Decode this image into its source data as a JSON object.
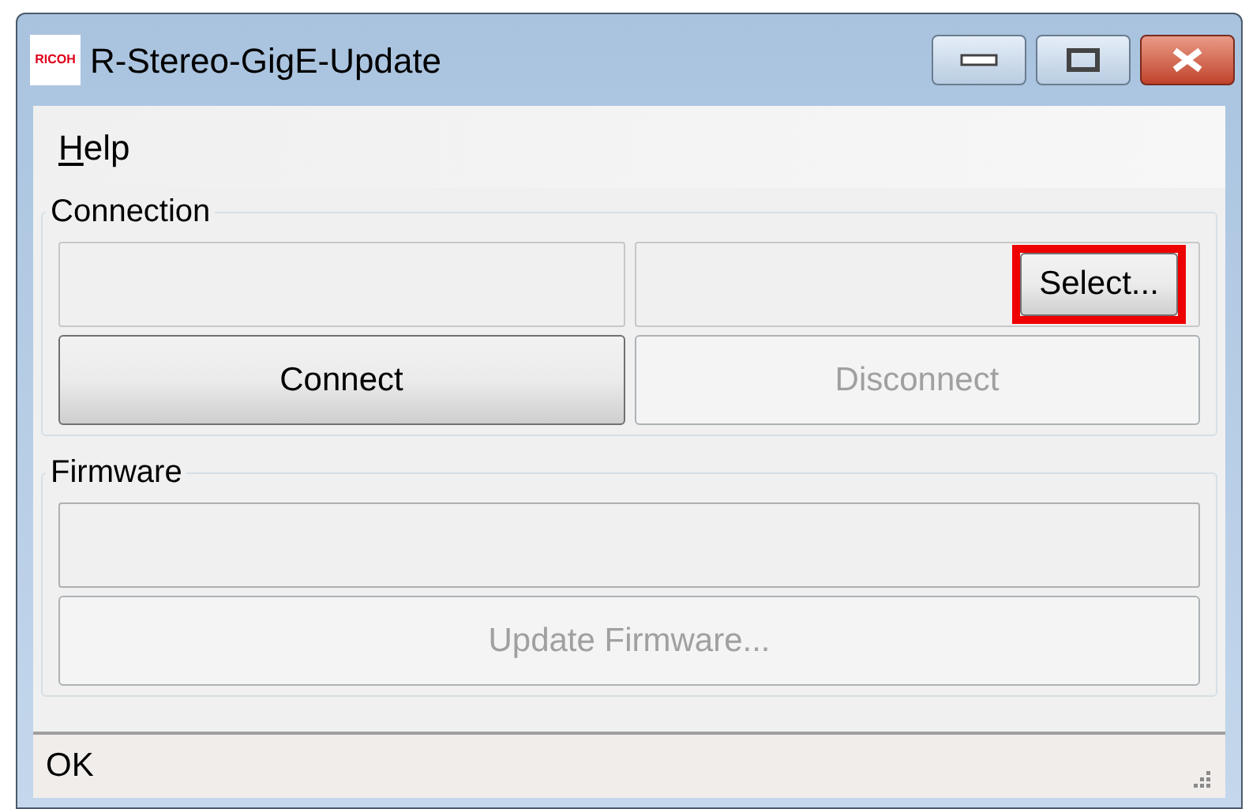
{
  "window": {
    "logo": "RICOH",
    "title": "R-Stereo-GigE-Update"
  },
  "menu": [
    {
      "label": "Help",
      "first_letter_underlined": true
    }
  ],
  "connection": {
    "title": "Connection",
    "select_button": {
      "label": "Select...",
      "disabled": false,
      "highlighted": true
    },
    "buttons": [
      {
        "label": "Connect",
        "disabled": false
      },
      {
        "label": "Disconnect",
        "disabled": true
      }
    ]
  },
  "firmware": {
    "title": "Firmware",
    "progress": {
      "level": 0
    },
    "button": {
      "label": "Update Firmware...",
      "disabled": true
    }
  },
  "status_bar": {
    "text": "OK"
  }
}
